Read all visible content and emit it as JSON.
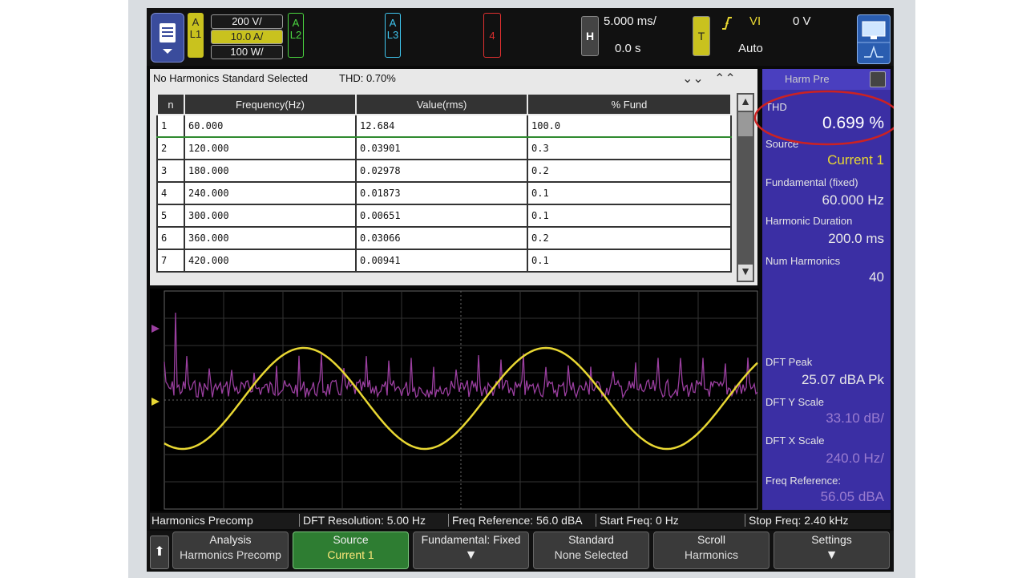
{
  "topbar": {
    "menu_icon": "menu-icon",
    "ch1": {
      "letter": "A",
      "name": "L1",
      "values": [
        "200 V/",
        "10.0 A/",
        "100 W/"
      ]
    },
    "ch2": {
      "letter": "A",
      "name": "L2"
    },
    "ch3": {
      "letter": "A",
      "name": "L3"
    },
    "ch4": {
      "name": "4"
    },
    "horizontal": {
      "label": "H",
      "timebase": "5.000 ms/",
      "delay": "0.0 s"
    },
    "trigger": {
      "label": "T",
      "source": "VI",
      "level": "0 V",
      "mode": "Auto",
      "edge_icon": "rising-edge-icon"
    }
  },
  "table": {
    "title": "No Harmonics Standard Selected",
    "thd_text": "THD: 0.70%",
    "columns": [
      "n",
      "Frequency(Hz)",
      "Value(rms)",
      "% Fund"
    ],
    "rows": [
      [
        "1",
        "60.000",
        "12.684",
        "100.0"
      ],
      [
        "2",
        "120.000",
        "0.03901",
        "0.3"
      ],
      [
        "3",
        "180.000",
        "0.02978",
        "0.2"
      ],
      [
        "4",
        "240.000",
        "0.01873",
        "0.1"
      ],
      [
        "5",
        "300.000",
        "0.00651",
        "0.1"
      ],
      [
        "6",
        "360.000",
        "0.03066",
        "0.2"
      ],
      [
        "7",
        "420.000",
        "0.00941",
        "0.1"
      ]
    ]
  },
  "side_panel": {
    "tab": "Harm Pre",
    "thd_label": "THD",
    "thd_value": "0.699 %",
    "source_label": "Source",
    "source_value": "Current 1",
    "fund_label": "Fundamental (fixed)",
    "fund_value": "60.000 Hz",
    "dur_label": "Harmonic Duration",
    "dur_value": "200.0 ms",
    "num_label": "Num Harmonics",
    "num_value": "40",
    "peak_label": "DFT Peak",
    "peak_value": "25.07 dBA Pk",
    "yscale_label": "DFT Y Scale",
    "yscale_value": "33.10 dB/",
    "xscale_label": "DFT X Scale",
    "xscale_value": "240.0 Hz/",
    "freqref_label": "Freq Reference:",
    "freqref_value": "56.05 dBA"
  },
  "status": {
    "mode": "Harmonics Precomp",
    "dft_res": "DFT Resolution: 5.00 Hz",
    "freq_ref": "Freq Reference: 56.0 dBA",
    "start": "Start Freq: 0 Hz",
    "stop": "Stop Freq: 2.40 kHz"
  },
  "softkeys": [
    {
      "l1": "Analysis",
      "l2": "Harmonics Precomp"
    },
    {
      "l1": "Source",
      "l2": "Current 1"
    },
    {
      "l1": "Fundamental: Fixed",
      "l2": ""
    },
    {
      "l1": "Standard",
      "l2": "None Selected"
    },
    {
      "l1": "Scroll",
      "l2": "Harmonics"
    },
    {
      "l1": "Settings",
      "l2": ""
    }
  ],
  "colors": {
    "ch1": "#e8d733",
    "fft": "#9b3fa0",
    "panel": "#3b2fa4",
    "highlight_circle": "#cc2222"
  }
}
